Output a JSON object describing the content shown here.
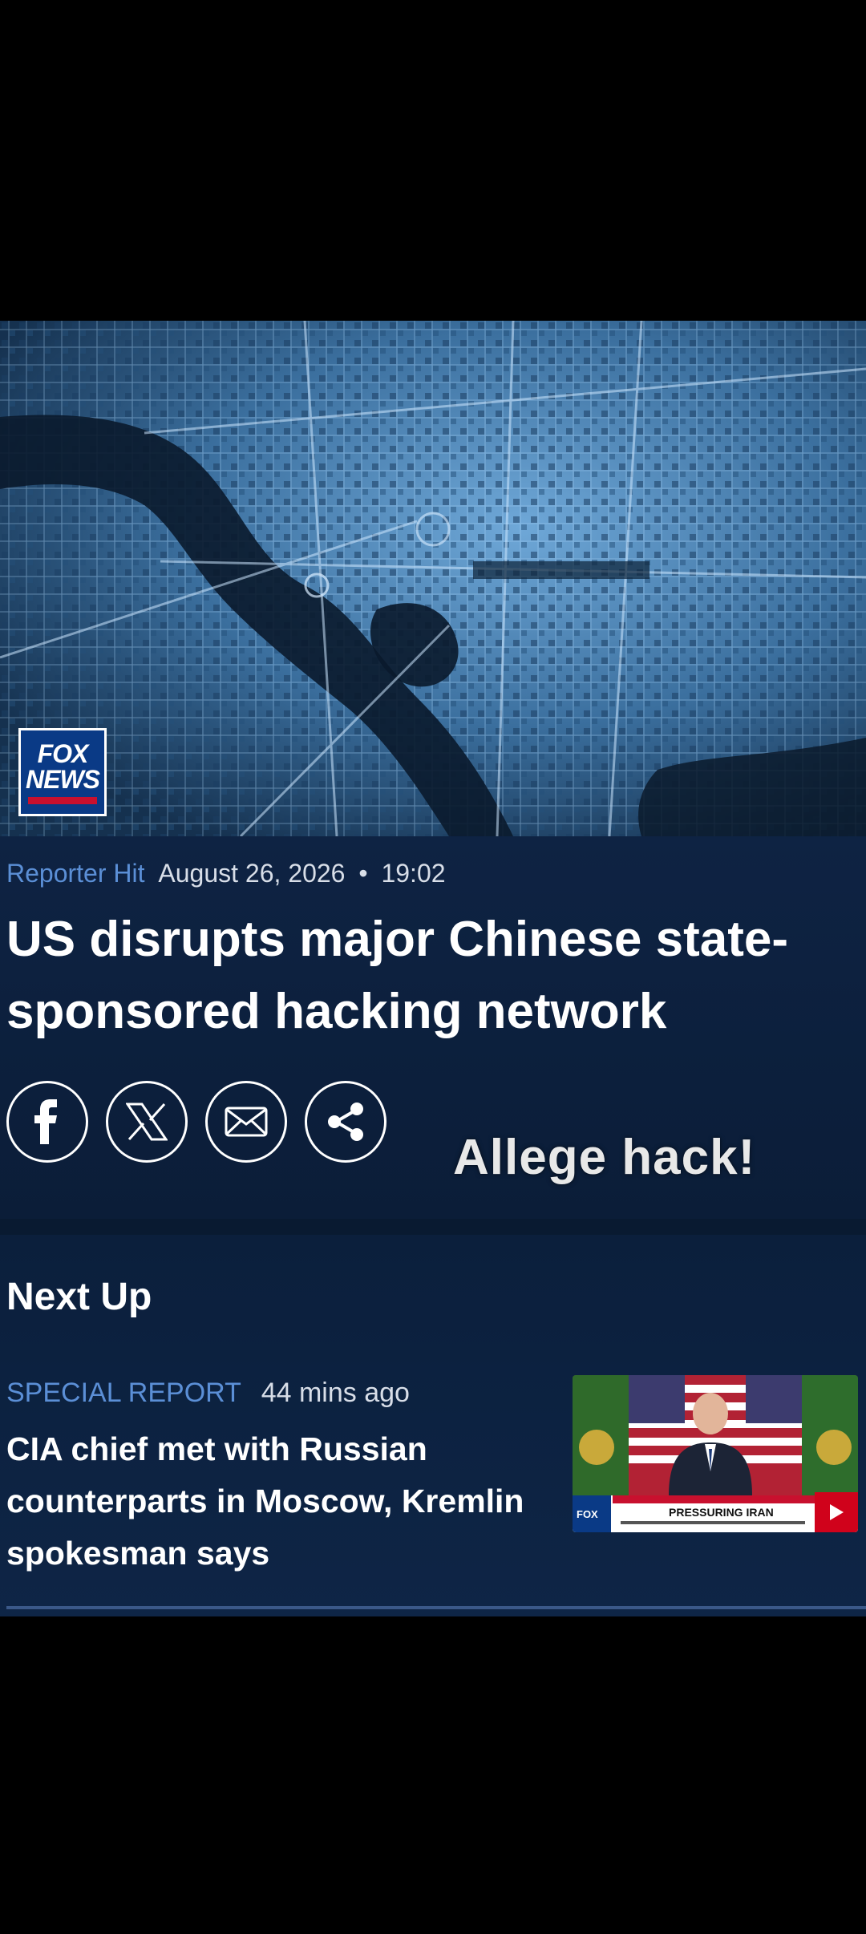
{
  "video": {
    "logo_line1": "FOX",
    "logo_line2": "NEWS"
  },
  "article": {
    "category": "Reporter Hit",
    "date": "August 26, 2026",
    "separator": "•",
    "time": "19:02",
    "headline": "US disrupts major Chinese state-sponsored hacking network",
    "share_buttons": [
      {
        "icon": "facebook-icon"
      },
      {
        "icon": "x-icon"
      },
      {
        "icon": "email-icon"
      },
      {
        "icon": "share-icon"
      }
    ],
    "overlay_caption": "Allege hack!"
  },
  "next_up": {
    "title": "Next Up",
    "story": {
      "tag": "SPECIAL REPORT",
      "ago": "44 mins ago",
      "title": "CIA chief met with Russian counterparts in Moscow, Kremlin spokesman says",
      "thumb_banner": "PRESSURING IRAN"
    }
  },
  "colors": {
    "accent_blue": "#5b8fd6",
    "background_navy": "#0e2343",
    "fox_red": "#c8102e"
  }
}
